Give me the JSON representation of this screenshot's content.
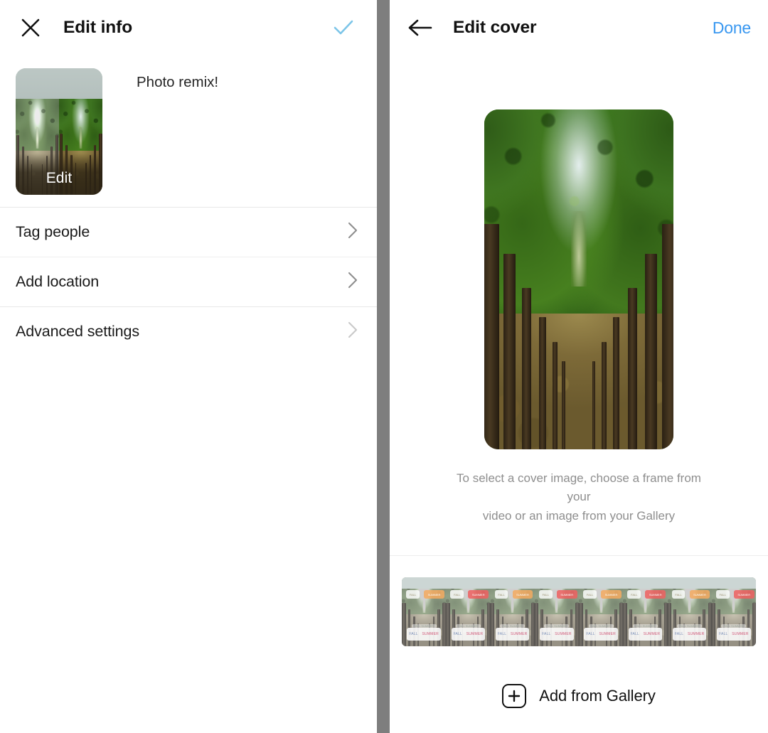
{
  "left_panel": {
    "header": {
      "close_icon": "close-icon",
      "title": "Edit info",
      "confirm_icon": "check-icon",
      "confirm_color": "#7cc5e8"
    },
    "media": {
      "thumbnail_overlay_label": "Edit",
      "caption": "Photo remix!"
    },
    "settings_rows": [
      {
        "label": "Tag people",
        "chevron": "chevron-right-icon",
        "chevron_color": "#8e8e8e"
      },
      {
        "label": "Add location",
        "chevron": "chevron-right-icon",
        "chevron_color": "#8e8e8e"
      },
      {
        "label": "Advanced settings",
        "chevron": "chevron-right-icon",
        "chevron_color": "#c9c9c9"
      }
    ]
  },
  "right_panel": {
    "header": {
      "back_icon": "arrow-left-icon",
      "title": "Edit cover",
      "done_label": "Done",
      "done_color": "#3897f0"
    },
    "cover_preview": {
      "alt": "tree-lined avenue with leaf covered path"
    },
    "hint_line_1": "To select a cover image, choose a frame from your",
    "hint_line_2": "video or an image from your Gallery",
    "filmstrip": {
      "frame_count": 8,
      "frames": [
        {
          "tag_left": "FALL",
          "tag_right": "SUMMER",
          "tag_right_color": "#f4aa60",
          "chip_left": "FALL",
          "chip_right": "SUMMER",
          "midline": "FALL SUMMER"
        },
        {
          "tag_left": "FALL",
          "tag_right": "SUMMER",
          "tag_right_color": "#ee6060",
          "chip_left": "FALL",
          "chip_right": "SUMMER",
          "midline": "FALL SUMMER"
        },
        {
          "tag_left": "FALL",
          "tag_right": "SUMMER",
          "tag_right_color": "#f4aa60",
          "chip_left": "FALL",
          "chip_right": "SUMMER",
          "midline": "FALL SUMMER"
        },
        {
          "tag_left": "FALL",
          "tag_right": "SUMMER",
          "tag_right_color": "#ee6060",
          "chip_left": "FALL",
          "chip_right": "SUMMER",
          "midline": "FALL SUMMER"
        },
        {
          "tag_left": "FALL",
          "tag_right": "SUMMER",
          "tag_right_color": "#f4aa60",
          "chip_left": "FALL",
          "chip_right": "SUMMER",
          "midline": "FALL SUMMER"
        },
        {
          "tag_left": "FALL",
          "tag_right": "SUMMER",
          "tag_right_color": "#ee6060",
          "chip_left": "FALL",
          "chip_right": "SUMMER",
          "midline": "FALL SUMMER"
        },
        {
          "tag_left": "FALL",
          "tag_right": "SUMMER",
          "tag_right_color": "#f4aa60",
          "chip_left": "FALL",
          "chip_right": "SUMMER",
          "midline": "FALL SUMMER"
        },
        {
          "tag_left": "FALL",
          "tag_right": "SUMMER",
          "tag_right_color": "#ee6060",
          "chip_left": "FALL",
          "chip_right": "SUMMER",
          "midline": "FALL SUMMER"
        }
      ]
    },
    "add_from_gallery": {
      "icon": "plus-box-icon",
      "label": "Add from Gallery"
    }
  },
  "theme": {
    "background": "#ffffff",
    "divider": "#7e7e7e",
    "row_separator": "#efefef",
    "text_primary": "#1a1a1a",
    "text_muted": "#8e8e8e"
  }
}
